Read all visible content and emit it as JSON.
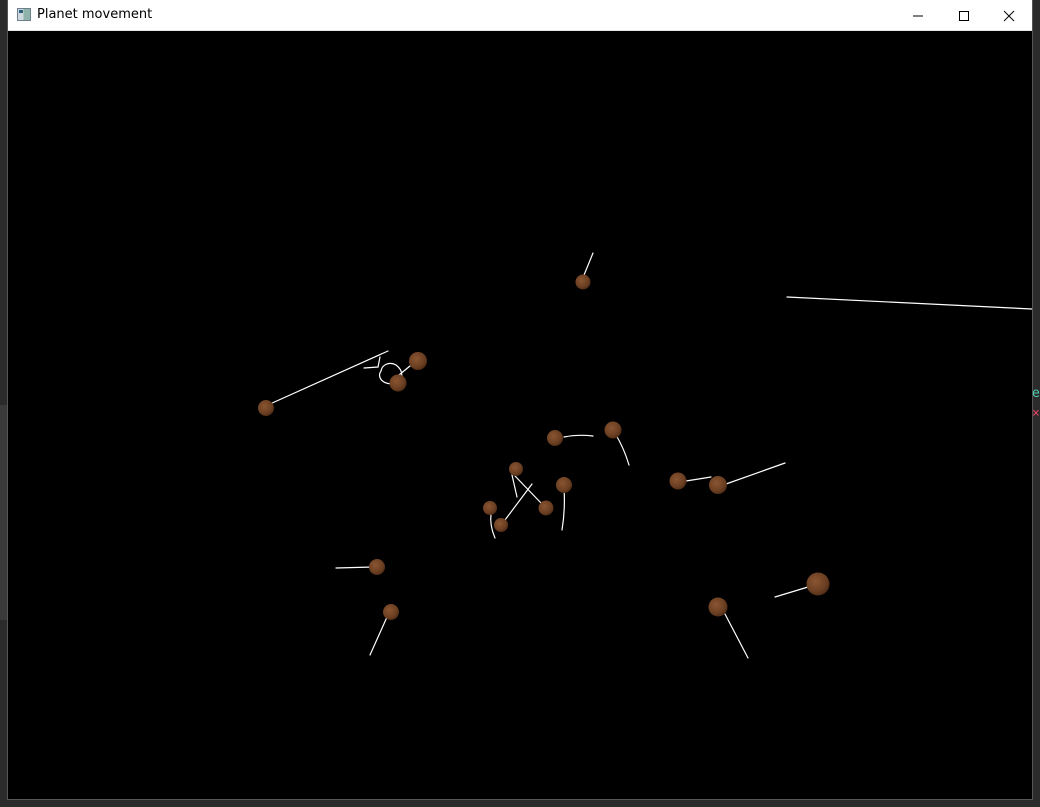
{
  "window": {
    "title": "Planet movement",
    "icon": "app-window-icon"
  },
  "caption_buttons": {
    "minimize_icon": "minimize-icon",
    "maximize_icon": "maximize-icon",
    "close_icon": "close-icon"
  },
  "colors": {
    "planet_fill": "#6b3f22",
    "planet_highlight": "#8a5532",
    "trail": "#ffffff",
    "space": "#000000"
  }
}
